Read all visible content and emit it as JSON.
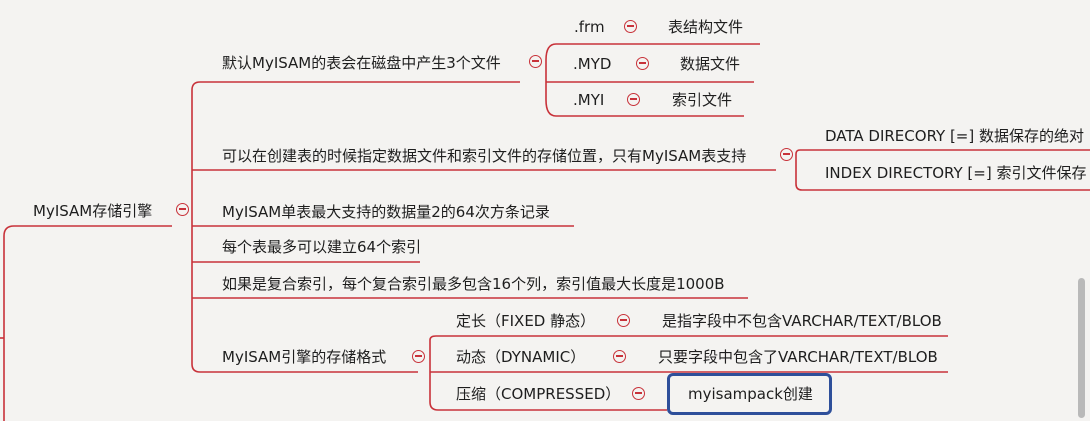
{
  "colors": {
    "branch_line": "#c8323a",
    "highlight": "#2e4f9a",
    "background": "#f4f3f1"
  },
  "mindmap": {
    "root": {
      "label": "MyISAM存储引擎"
    },
    "files": {
      "label": "默认MyISAM的表会在磁盘中产生3个文件",
      "items": [
        {
          "ext": ".frm",
          "desc": "表结构文件"
        },
        {
          "ext": ".MYD",
          "desc": "数据文件"
        },
        {
          "ext": ".MYI",
          "desc": "索引文件"
        }
      ]
    },
    "location": {
      "label": "可以在创建表的时候指定数据文件和索引文件的存储位置，只有MyISAM表支持",
      "items": [
        {
          "label": "DATA DIRECORY [=] 数据保存的绝对"
        },
        {
          "label": "INDEX DIRECTORY [=] 索引文件保存"
        }
      ]
    },
    "max_data": {
      "label": "MyISAM单表最大支持的数据量2的64次方条记录"
    },
    "max_index": {
      "label": "每个表最多可以建立64个索引"
    },
    "composite": {
      "label": "如果是复合索引，每个复合索引最多包含16个列，索引值最大长度是1000B"
    },
    "formats": {
      "label": "MyISAM引擎的存储格式",
      "items": [
        {
          "name": "定长（FIXED 静态）",
          "desc": "是指字段中不包含VARCHAR/TEXT/BLOB"
        },
        {
          "name": "动态（DYNAMIC）",
          "desc": "只要字段中包含了VARCHAR/TEXT/BLOB"
        },
        {
          "name": "压缩（COMPRESSED）",
          "desc": "myisampack创建"
        }
      ]
    }
  }
}
